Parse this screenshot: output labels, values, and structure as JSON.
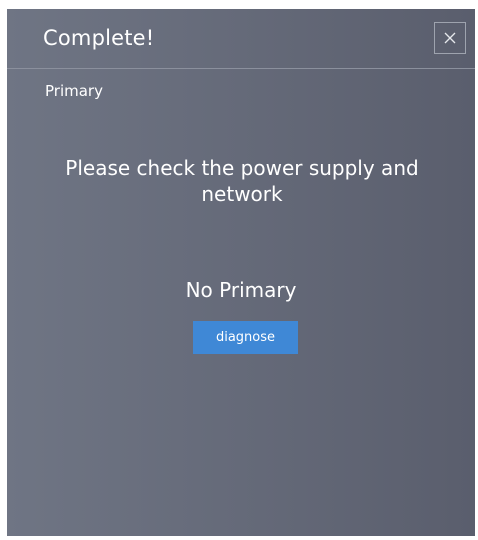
{
  "dialog": {
    "title": "Complete!",
    "close_icon": "close-icon",
    "section_label": "Primary",
    "message": "Please check the power supply and network",
    "status": "No Primary",
    "diagnose_label": "diagnose"
  },
  "colors": {
    "background_left": "#6f7584",
    "background_right": "#5a5e6d",
    "text": "#ffffff",
    "button": "#3f88d6",
    "divider": "#8b909d"
  }
}
